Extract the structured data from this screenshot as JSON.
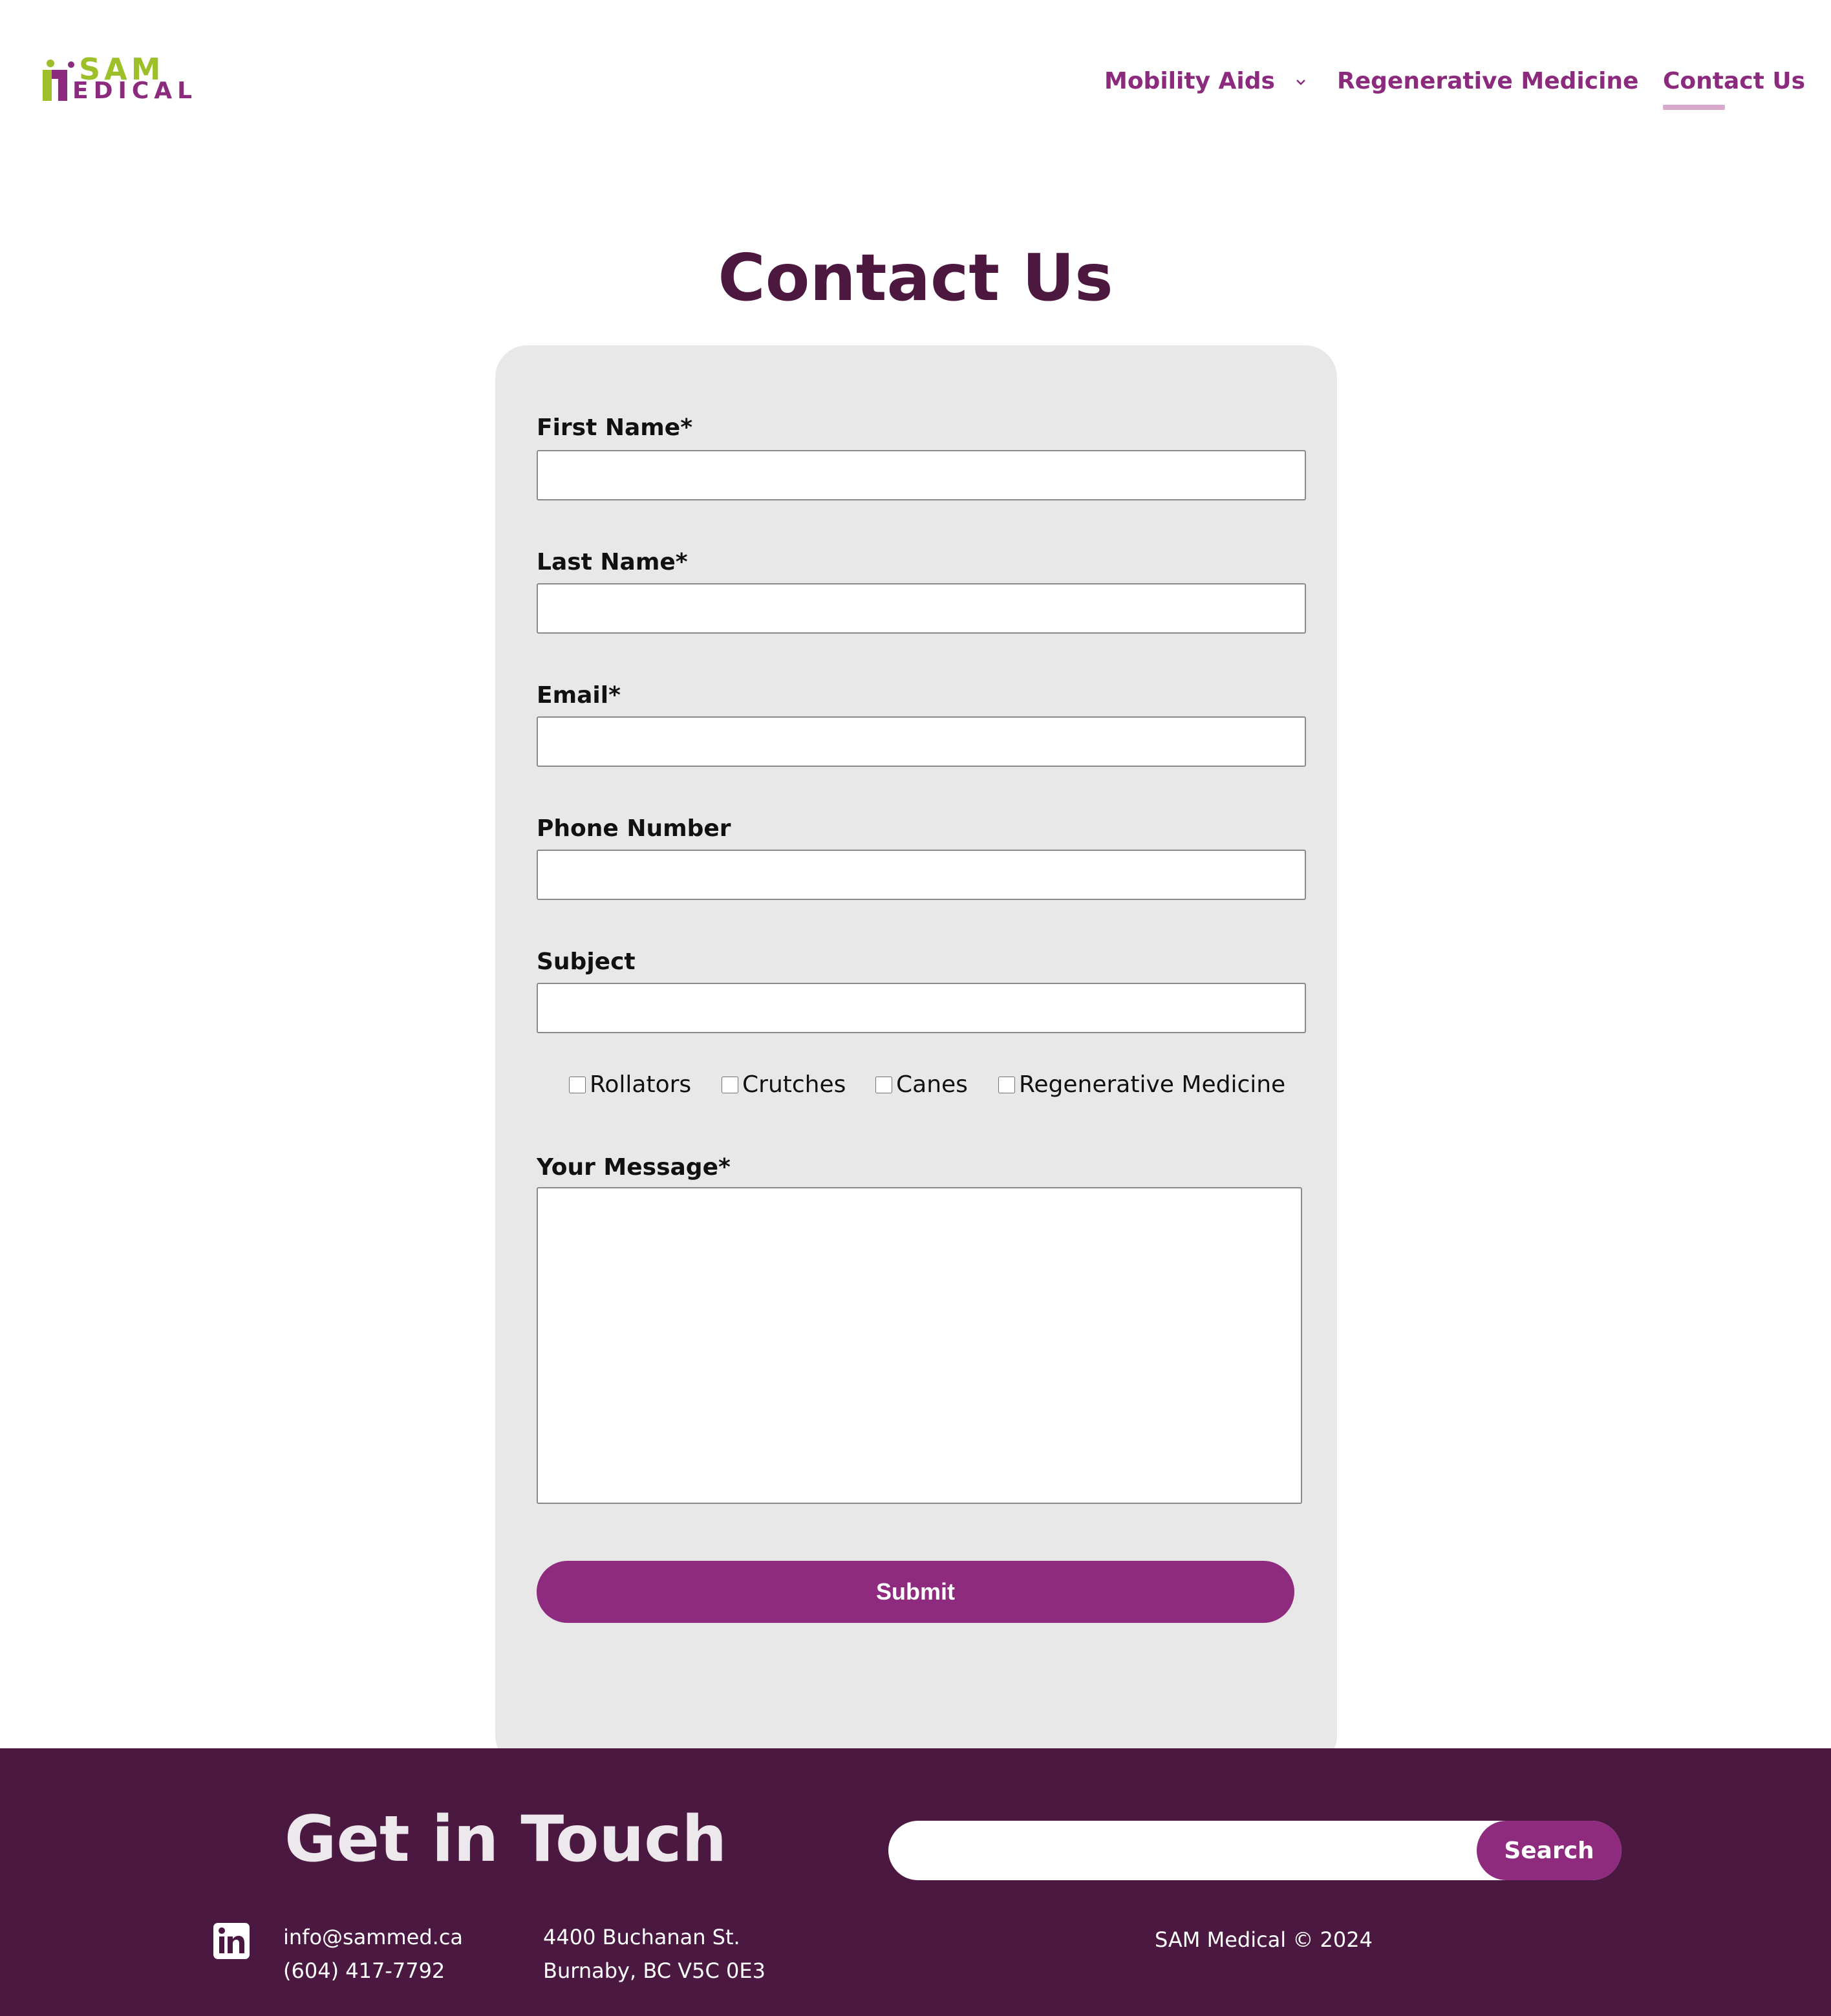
{
  "brand": {
    "logo_top": "SAM",
    "logo_bottom": "EDICAL",
    "green": "#9dc02a",
    "purple": "#8c2b7e"
  },
  "nav": {
    "items": [
      {
        "label": "Mobility Aids",
        "has_dropdown": true
      },
      {
        "label": "Regenerative Medicine"
      },
      {
        "label": "Contact Us",
        "active": true
      }
    ],
    "active_underline_color": "#d9a9cc"
  },
  "page": {
    "title": "Contact Us",
    "title_color": "#4c1840"
  },
  "form": {
    "first_name": {
      "label": "First Name*",
      "value": ""
    },
    "last_name": {
      "label": "Last Name*",
      "value": ""
    },
    "email": {
      "label": "Email*",
      "value": ""
    },
    "phone": {
      "label": "Phone Number",
      "value": ""
    },
    "subject": {
      "label": "Subject",
      "value": ""
    },
    "checkboxes": [
      {
        "label": "Rollators",
        "checked": false
      },
      {
        "label": "Crutches",
        "checked": false
      },
      {
        "label": "Canes",
        "checked": false
      },
      {
        "label": "Regenerative Medicine",
        "checked": false
      }
    ],
    "message": {
      "label": "Your Message*",
      "value": ""
    },
    "submit_label": "Submit",
    "card_color": "#e8e8e8",
    "button_color": "#8f2b7e"
  },
  "footer": {
    "title": "Get in Touch",
    "search": {
      "placeholder": "",
      "button_label": "Search"
    },
    "social_icon": "linkedin-icon",
    "email": "info@sammed.ca",
    "phone": "(604) 417-7792",
    "address_line1": "4400 Buchanan St.",
    "address_line2": "Burnaby, BC V5C 0E3",
    "copyright": "SAM Medical © 2024",
    "background": "#4a1840"
  }
}
